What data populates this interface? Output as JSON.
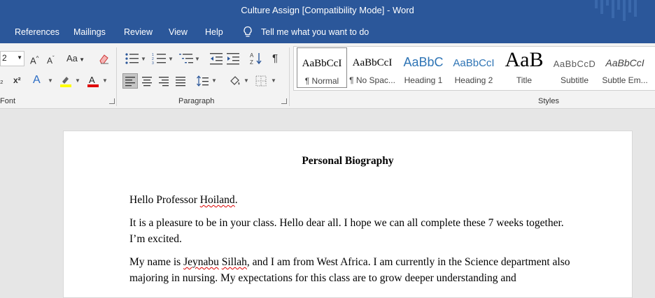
{
  "window": {
    "title": "Culture Assign [Compatibility Mode]  -  Word"
  },
  "tabs": [
    "References",
    "Mailings",
    "Review",
    "View",
    "Help"
  ],
  "tell_me": "Tell me what you want to do",
  "ribbon": {
    "font_size": "2",
    "groups": {
      "font": "Font",
      "paragraph": "Paragraph",
      "styles": "Styles"
    },
    "font_case_label": "Aa",
    "styles": [
      {
        "preview": "AaBbCcI",
        "name": "¶ Normal"
      },
      {
        "preview": "AaBbCcI",
        "name": "¶ No Spac..."
      },
      {
        "preview": "AaBbC",
        "name": "Heading 1"
      },
      {
        "preview": "AaBbCcI",
        "name": "Heading 2"
      },
      {
        "preview": "AaB",
        "name": "Title"
      },
      {
        "preview": "AaBbCcD",
        "name": "Subtitle"
      },
      {
        "preview": "AaBbCcI",
        "name": "Subtle Em..."
      }
    ],
    "colors": {
      "highlight": "#ffff00",
      "font_color": "#e00000",
      "accent": "#2b579a"
    }
  },
  "document": {
    "title": "Personal Biography",
    "p1": {
      "a": "Hello Professor ",
      "b": "Hoiland",
      "c": "."
    },
    "p2": "It is a pleasure to be in your class. Hello dear all. I hope we can all complete these 7 weeks together. I’m excited.",
    "p3": {
      "a": "My name is ",
      "b": "Jeynabu",
      "c": " ",
      "d": "Sillah",
      "e": ", and I am from West Africa. I am currently in the Science department also majoring in nursing. My expectations for this class are to grow deeper understanding and"
    }
  }
}
